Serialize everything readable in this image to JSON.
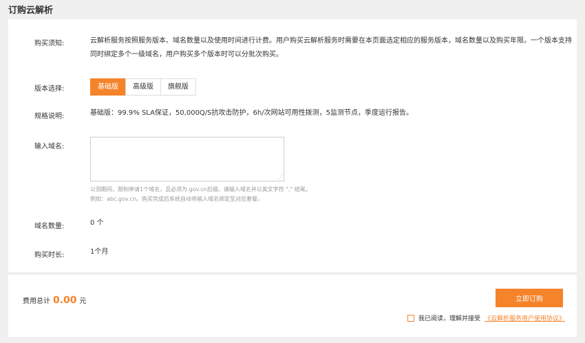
{
  "page": {
    "title": "订购云解析"
  },
  "purchase_notice": {
    "label": "购买须知:",
    "text": "云解析服务按照服务版本、域名数量以及使用时间进行计费。用户购买云解析服务时需要在本页面选定相应的服务版本，域名数量以及购买年限。一个版本支持同时绑定多个一级域名，用户购买多个版本时可以分批次购买。"
  },
  "version": {
    "label": "版本选择:",
    "options": [
      "基础版",
      "高级版",
      "旗舰版"
    ],
    "selected": "基础版"
  },
  "spec": {
    "label": "规格说明:",
    "text": "基础版：99.9% SLA保证，50,000Q/S抗攻击防护，6h/次网站可用性拨测，5监测节点，季度运行报告。"
  },
  "domain_input": {
    "label": "输入域名:",
    "value": "",
    "hint_line1": "公测期间，限制申请1个域名，且必须为.gov.cn后缀。请输入域名并以英文字符 \",\" 结尾。",
    "hint_line2": "例如：abc.gov.cn。购买完成后系统自动将输入域名绑定至对应套餐。"
  },
  "domain_count": {
    "label": "域名数量:",
    "value": "0 个"
  },
  "duration": {
    "label": "购买时长:",
    "value": "1个月"
  },
  "footer": {
    "total_label": "费用总计",
    "total_amount": "0.00",
    "currency": "元",
    "buy_button": "立即订购",
    "agree_text": "我已阅读，理解并接受",
    "agree_link": "《云解析服务用户使用协议》",
    "agree_checked": false
  },
  "colors": {
    "accent": "#f5832a"
  }
}
